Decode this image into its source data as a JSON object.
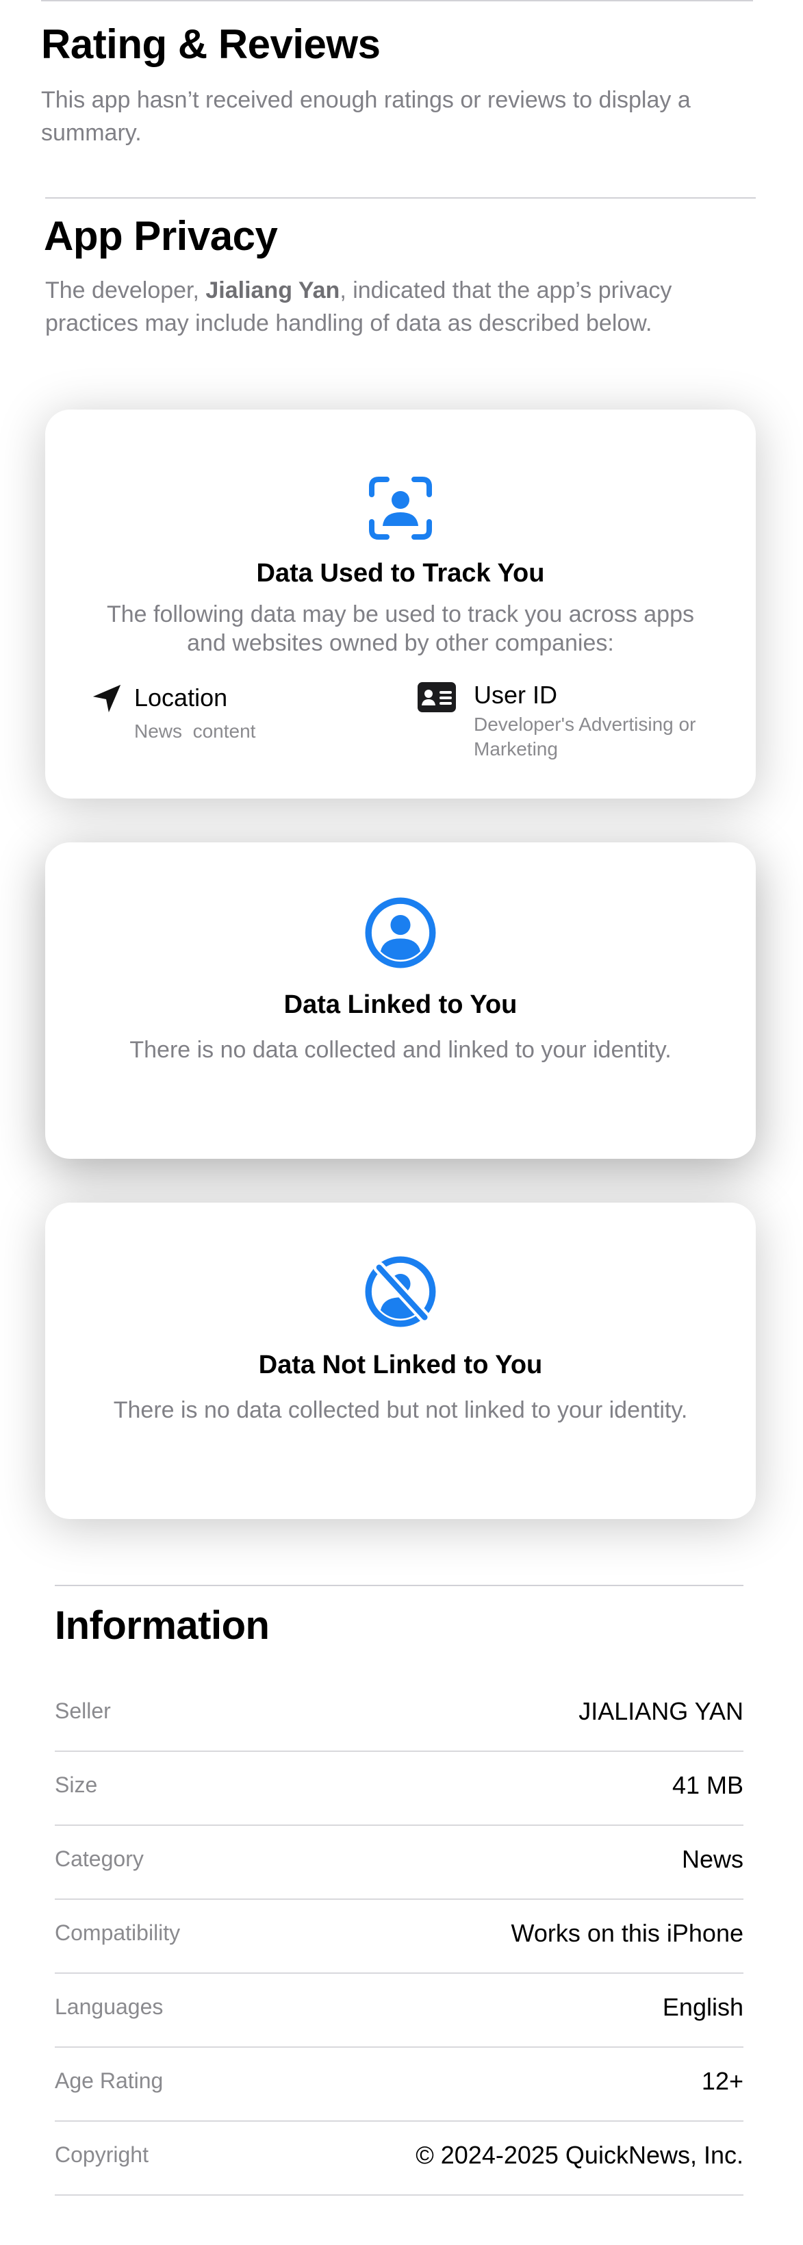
{
  "ratings": {
    "title": "Rating & Reviews",
    "message": "This app hasn’t received enough ratings or reviews to display a summary."
  },
  "privacy": {
    "title": "App Privacy",
    "intro_prefix": "The developer, ",
    "developer": "Jialiang Yan",
    "intro_suffix": ", indicated that the app’s privacy practices may include handling of data as described below.",
    "cards": [
      {
        "icon": "tracking-icon",
        "title": "Data Used to Track You",
        "description": "The following data may be used to track you across apps and websites owned by other companies:",
        "items": [
          {
            "icon": "location-arrow-icon",
            "label": "Location",
            "purpose": "News  content"
          },
          {
            "icon": "id-card-icon",
            "label": "User ID",
            "purpose": "Developer's Advertising or Marketing"
          }
        ]
      },
      {
        "icon": "person-circle-icon",
        "title": "Data Linked to You",
        "description": "There is no data collected and linked to your identity."
      },
      {
        "icon": "person-slash-icon",
        "title": "Data Not Linked to You",
        "description": "There is no data collected but not linked to your identity."
      }
    ]
  },
  "information": {
    "title": "Information",
    "rows": [
      {
        "key": "Seller",
        "value": "JIALIANG YAN"
      },
      {
        "key": "Size",
        "value": "41 MB"
      },
      {
        "key": "Category",
        "value": "News"
      },
      {
        "key": "Compatibility",
        "value": "Works on this iPhone"
      },
      {
        "key": "Languages",
        "value": "English"
      },
      {
        "key": "Age Rating",
        "value": "12+"
      },
      {
        "key": "Copyright",
        "value": "© 2024-2025 QuickNews, Inc."
      }
    ]
  },
  "colors": {
    "accent": "#1a7ff0",
    "secondary_text": "#808086",
    "divider": "#d1d1d6"
  }
}
